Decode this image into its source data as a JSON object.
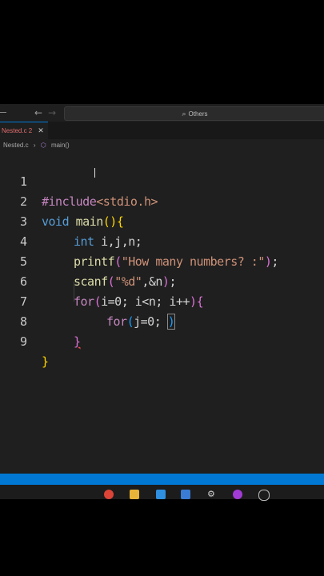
{
  "titlebar": {
    "back_icon": "arrow-left-icon",
    "forward_icon": "arrow-right-icon",
    "search_text": "Others"
  },
  "tab": {
    "label": "Nested.c 2",
    "close_symbol": "✕"
  },
  "breadcrumb": {
    "file": "Nested.c",
    "symbol": "main()"
  },
  "code": {
    "line_numbers": [
      "1",
      "2",
      "3",
      "4",
      "5",
      "6",
      "7",
      "8",
      "9"
    ],
    "l1_include": "#include",
    "l1_header": "<stdio.h>",
    "l2_void": "void ",
    "l2_main": "main",
    "l2_paren": "()",
    "l2_brace": "{",
    "l3_int": "int ",
    "l3_rest": "i,j,n;",
    "l4_fn": "printf",
    "l4_po": "(",
    "l4_str": "\"How many numbers? :\"",
    "l4_pc": ")",
    "l4_semi": ";",
    "l5_fn": "scanf",
    "l5_po": "(",
    "l5_str": "\"%d\"",
    "l5_rest": ",&n",
    "l5_pc": ")",
    "l5_semi": ";",
    "l6_for": "for",
    "l6_po": "(",
    "l6_rest": "i=0; i<n; i++",
    "l6_pc": ")",
    "l6_brace": "{",
    "l7_for": "for",
    "l7_po": "(",
    "l7_rest": "j=0; ",
    "l7_pc": ")",
    "l8_brace": "}",
    "l9_brace": "}"
  },
  "colors": {
    "accent": "#0078d4",
    "editor_bg": "#1f1f1f"
  }
}
